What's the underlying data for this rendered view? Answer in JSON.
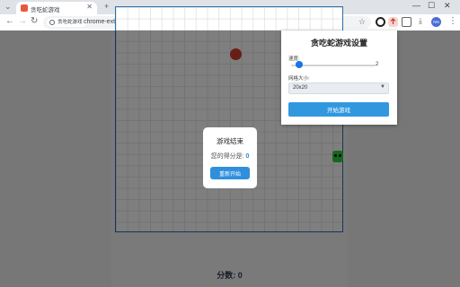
{
  "browser": {
    "tab_title": "贪吃蛇游戏",
    "tab_close": "✕",
    "new_tab": "+",
    "window_controls": {
      "minimize": "—",
      "maximize": "☐",
      "close": "✕"
    },
    "nav": {
      "back": "←",
      "forward": "→",
      "reload": "↻"
    },
    "site_chip": "贪吃蛇游戏",
    "url": "chrome-extension://eiobehcgdeoekbbiajehlckaainmkjd/game.html",
    "bookmark": "☆",
    "menu": "⋮",
    "menu_list": "⌄",
    "profile_initials": "NN",
    "icons": [
      "info-icon",
      "lock-icon",
      "star-icon",
      "extension-icon",
      "puzzle-icon",
      "download-icon",
      "profile-icon",
      "menu-icon"
    ]
  },
  "game": {
    "score_label": "分数: 0",
    "over_title": "游戏结束",
    "over_score_label": "您的得分是:",
    "over_score_value": "0",
    "restart_label": "重新开始"
  },
  "settings": {
    "title": "贪吃蛇游戏设置",
    "speed_label": "速度:",
    "speed_value": "2",
    "speed_fraction": 0.1,
    "grid_label": "网格大小:",
    "grid_value": "20x20",
    "start_label": "开始游戏"
  },
  "colors": {
    "accent": "#2f8fdd",
    "food": "#d13b2f",
    "snake": "#2ecc40",
    "board_border": "#2a6fb0"
  }
}
